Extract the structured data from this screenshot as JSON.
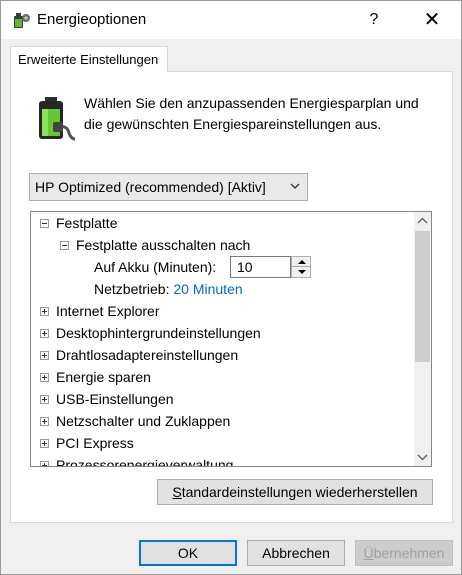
{
  "window": {
    "title": "Energieoptionen",
    "help_label": "?",
    "close_label": "✕",
    "icon": "power-options-icon"
  },
  "tab": {
    "label": "Erweiterte Einstellungen"
  },
  "intro": {
    "icon": "battery-plug-icon",
    "text": "Wählen Sie den anzupassenden Energiesparplan und die gewünschten Energiespareinstellungen aus."
  },
  "plan_select": {
    "value": "HP Optimized (recommended) [Aktiv]"
  },
  "tree": {
    "festplatte": "Festplatte",
    "ausschalten": "Festplatte ausschalten nach",
    "akku_label": "Auf Akku (Minuten):",
    "akku_value": "10",
    "netz_label": "Netzbetrieb:",
    "netz_value": "20 Minuten",
    "items": [
      "Internet Explorer",
      "Desktophintergrundeinstellungen",
      "Drahtlosadaptereinstellungen",
      "Energie sparen",
      "USB-Einstellungen",
      "Netzschalter und Zuklappen",
      "PCI Express",
      "Prozessorenergieverwaltung"
    ]
  },
  "buttons": {
    "restore_mnemonic": "S",
    "restore_rest": "tandardeinstellungen wiederherstellen",
    "ok": "OK",
    "cancel": "Abbrechen",
    "apply_mnemonic": "Ü",
    "apply_rest": "bernehmen"
  },
  "colors": {
    "accent": "#0078d7",
    "link": "#0066cc"
  }
}
